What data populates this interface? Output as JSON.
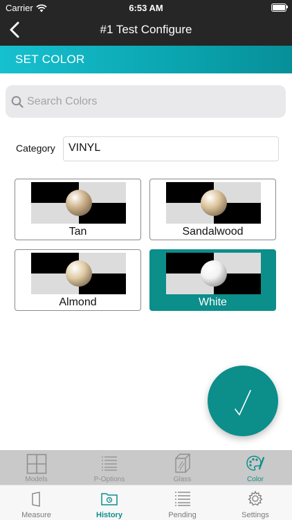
{
  "status": {
    "carrier": "Carrier",
    "time": "6:53 AM"
  },
  "nav": {
    "title": "#1 Test Configure"
  },
  "band": {
    "title": "SET COLOR"
  },
  "search": {
    "placeholder": "Search Colors",
    "value": ""
  },
  "category": {
    "label": "Category",
    "value": "VINYL"
  },
  "colors": [
    {
      "name": "Tan",
      "selected": false,
      "sphere": "#cdb28a"
    },
    {
      "name": "Sandalwood",
      "selected": false,
      "sphere": "#dcc39a"
    },
    {
      "name": "Almond",
      "selected": false,
      "sphere": "#e0cba4"
    },
    {
      "name": "White",
      "selected": true,
      "sphere": "#f2f2f2"
    }
  ],
  "tabs_top": [
    {
      "label": "Models",
      "icon": "grid-icon"
    },
    {
      "label": "P-Options",
      "icon": "list-icon"
    },
    {
      "label": "Glass",
      "icon": "glass-pane-icon"
    },
    {
      "label": "Color",
      "icon": "palette-icon",
      "active": true
    }
  ],
  "tabs_bottom": [
    {
      "label": "Measure",
      "icon": "door-icon"
    },
    {
      "label": "History",
      "icon": "folder-icon",
      "active": true
    },
    {
      "label": "Pending",
      "icon": "list-icon"
    },
    {
      "label": "Settings",
      "icon": "gear-icon"
    }
  ],
  "accent": "#0c8e8b"
}
